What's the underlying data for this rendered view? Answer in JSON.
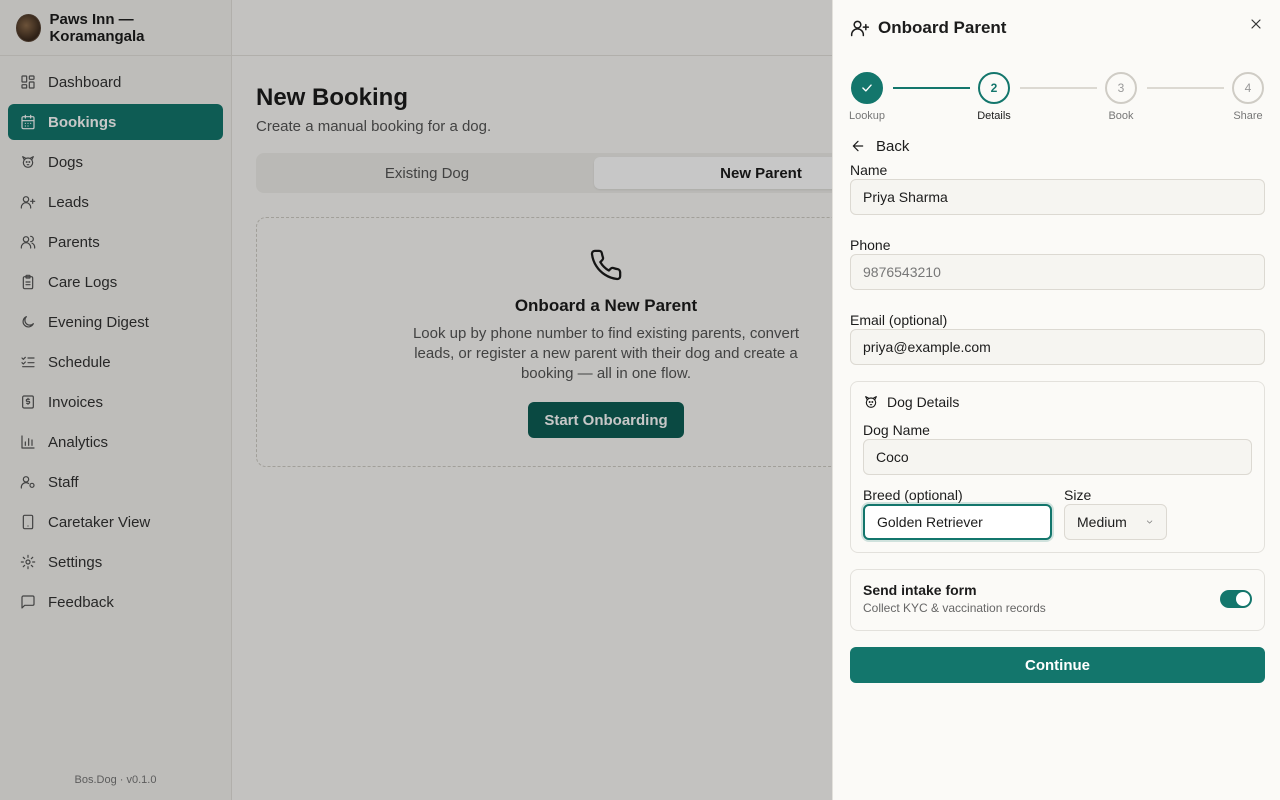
{
  "sidebar": {
    "brand": "Paws Inn — Koramangala",
    "items": [
      {
        "label": "Dashboard",
        "icon": "grid-icon"
      },
      {
        "label": "Bookings",
        "icon": "calendar-icon",
        "active": true
      },
      {
        "label": "Dogs",
        "icon": "dog-icon"
      },
      {
        "label": "Leads",
        "icon": "user-plus-icon"
      },
      {
        "label": "Parents",
        "icon": "users-icon"
      },
      {
        "label": "Care Logs",
        "icon": "clipboard-icon"
      },
      {
        "label": "Evening Digest",
        "icon": "moon-icon"
      },
      {
        "label": "Schedule",
        "icon": "checklist-icon"
      },
      {
        "label": "Invoices",
        "icon": "receipt-icon"
      },
      {
        "label": "Analytics",
        "icon": "bar-chart-icon"
      },
      {
        "label": "Staff",
        "icon": "user-cog-icon"
      },
      {
        "label": "Caretaker View",
        "icon": "tablet-icon"
      },
      {
        "label": "Settings",
        "icon": "gear-icon"
      },
      {
        "label": "Feedback",
        "icon": "message-icon"
      }
    ],
    "version": "Bos.Dog · v0.1.0"
  },
  "main": {
    "title": "New Booking",
    "subtitle": "Create a manual booking for a dog.",
    "tabs": [
      "Existing Dog",
      "New Parent"
    ],
    "card": {
      "title": "Onboard a New Parent",
      "description": "Look up by phone number to find existing parents, convert leads, or register a new parent with their dog and create a booking — all in one flow.",
      "button": "Start Onboarding"
    }
  },
  "sheet": {
    "title": "Onboard Parent",
    "steps": [
      {
        "label": "Lookup",
        "num": "1"
      },
      {
        "label": "Details",
        "num": "2"
      },
      {
        "label": "Book",
        "num": "3"
      },
      {
        "label": "Share",
        "num": "4"
      }
    ],
    "back": "Back",
    "name_label": "Name",
    "name_value": "Priya Sharma",
    "phone_label": "Phone",
    "phone_value": "9876543210",
    "email_label": "Email (optional)",
    "email_value": "priya@example.com",
    "dog": {
      "heading": "Dog Details",
      "name_label": "Dog Name",
      "name_value": "Coco",
      "breed_label": "Breed (optional)",
      "breed_value": "Golden Retriever",
      "size_label": "Size",
      "size_value": "Medium"
    },
    "intake": {
      "title": "Send intake form",
      "desc": "Collect KYC & vaccination records",
      "enabled": true
    },
    "continue": "Continue"
  },
  "colors": {
    "accent": "#13766c"
  }
}
